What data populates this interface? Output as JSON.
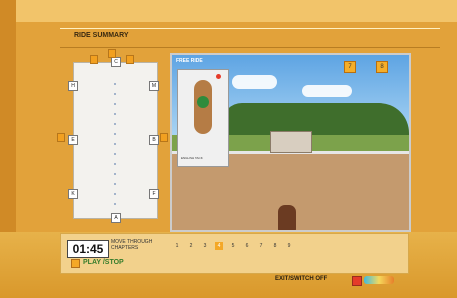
{
  "header": {
    "title": "RIDE SUMMARY"
  },
  "arena_markers": {
    "top": "C",
    "left": [
      "H",
      "E",
      "K"
    ],
    "right": [
      "M",
      "B",
      "F"
    ],
    "bottom": "A",
    "top_tags": [
      "3",
      "4",
      "5"
    ],
    "side_tags": [
      "2",
      "6"
    ]
  },
  "video": {
    "label": "FREE RIDE",
    "overlay_caption": "ENGLISH TACK",
    "buttons": [
      {
        "key": "7",
        "label": ""
      },
      {
        "key": "8",
        "label": ""
      }
    ]
  },
  "controls": {
    "time": "01:45",
    "move_through": "MOVE THROUGH CHAPTERS",
    "chapters": [
      "1",
      "2",
      "3",
      "4",
      "5",
      "6",
      "7",
      "8",
      "9"
    ],
    "active_chapter": "4",
    "play_stop": "PLAY /STOP"
  },
  "footer": {
    "exit": "EXIT/SWITCH OFF"
  }
}
